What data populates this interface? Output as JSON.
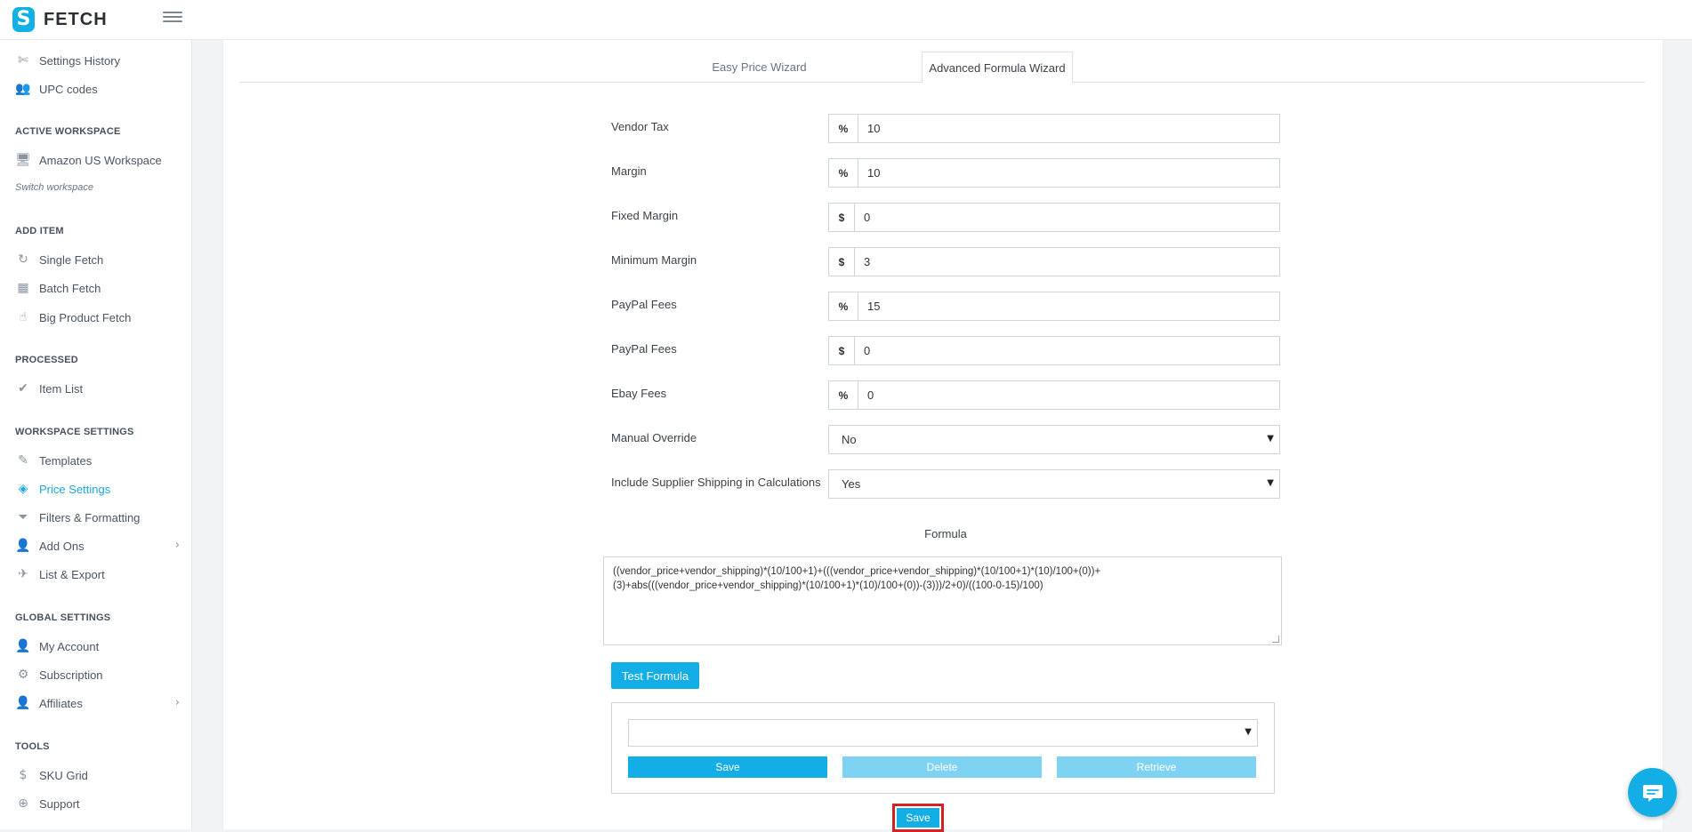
{
  "app": {
    "brand": "FETCH",
    "brand_mark": "S"
  },
  "sidebar": {
    "top_items": [
      {
        "label": "Settings History",
        "icon": "tools-icon",
        "glyph": "✄"
      },
      {
        "label": "UPC codes",
        "icon": "users-icon",
        "glyph": "👥"
      }
    ],
    "sections": {
      "active_workspace": "ACTIVE WORKSPACE",
      "add_item": "ADD ITEM",
      "processed": "PROCESSED",
      "workspace_settings": "WORKSPACE SETTINGS",
      "global_settings": "GLOBAL SETTINGS",
      "tools": "TOOLS"
    },
    "workspace": {
      "label": "Amazon US Workspace",
      "icon": "monitor-icon",
      "glyph": "🖥"
    },
    "switch_workspace": "Switch workspace",
    "add_item": [
      {
        "label": "Single Fetch",
        "glyph": "↻"
      },
      {
        "label": "Batch Fetch",
        "glyph": "▦"
      },
      {
        "label": "Big Product Fetch",
        "glyph": "☝"
      }
    ],
    "processed": [
      {
        "label": "Item List",
        "glyph": "✔"
      }
    ],
    "workspace_settings": [
      {
        "label": "Templates",
        "glyph": "✎"
      },
      {
        "label": "Price Settings",
        "glyph": "◈"
      },
      {
        "label": "Filters & Formatting",
        "glyph": "⏷"
      },
      {
        "label": "Add Ons",
        "glyph": "👤"
      },
      {
        "label": "List & Export",
        "glyph": "✈"
      }
    ],
    "global_settings": [
      {
        "label": "My Account",
        "glyph": "👤"
      },
      {
        "label": "Subscription",
        "glyph": "⚙"
      },
      {
        "label": "Affiliates",
        "glyph": "👤"
      }
    ],
    "tools": [
      {
        "label": "SKU Grid",
        "glyph": "$"
      },
      {
        "label": "Support",
        "glyph": "⊕"
      }
    ],
    "chevron": "›"
  },
  "tabs": {
    "easy": "Easy Price Wizard",
    "advanced": "Advanced Formula Wizard"
  },
  "form": {
    "vendor_tax": {
      "label": "Vendor Tax",
      "unit": "%",
      "value": "10"
    },
    "margin": {
      "label": "Margin",
      "unit": "%",
      "value": "10"
    },
    "fixed_margin": {
      "label": "Fixed Margin",
      "unit": "$",
      "value": "0"
    },
    "minimum_margin": {
      "label": "Minimum Margin",
      "unit": "$",
      "value": "3"
    },
    "paypal_fees_pct": {
      "label": "PayPal Fees",
      "unit": "%",
      "value": "15"
    },
    "paypal_fees_fixed": {
      "label": "PayPal Fees",
      "unit": "$",
      "value": "0"
    },
    "ebay_fees": {
      "label": "Ebay Fees",
      "unit": "%",
      "value": "0"
    },
    "manual_override": {
      "label": "Manual Override",
      "value": "No"
    },
    "include_shipping": {
      "label": "Include Supplier Shipping in Calculations",
      "value": "Yes"
    }
  },
  "formula": {
    "title": "Formula",
    "text": "((vendor_price+vendor_shipping)*(10/100+1)+(((vendor_price+vendor_shipping)*(10/100+1)*(10)/100+(0))+(3)+abs(((vendor_price+vendor_shipping)*(10/100+1)*(10)/100+(0))-(3)))/2+0)/((100-0-15)/100)",
    "test_button": "Test Formula"
  },
  "presets": {
    "selected": "",
    "save": "Save",
    "delete": "Delete",
    "retrieve": "Retrieve"
  },
  "main_save": "Save",
  "colors": {
    "accent": "#13aee5",
    "accent_light": "#7fd3f2",
    "highlight": "#d42222"
  }
}
